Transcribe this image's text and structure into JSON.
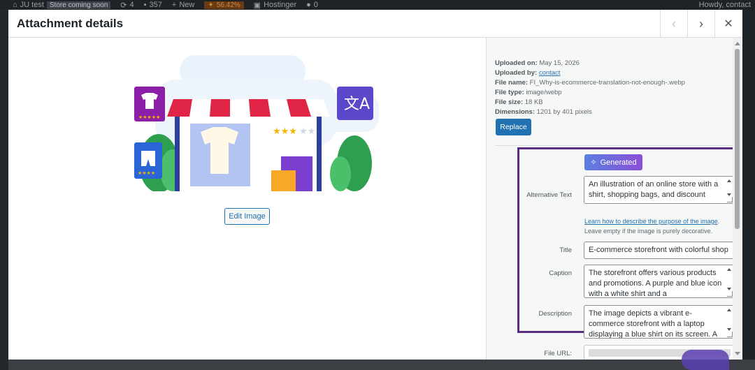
{
  "admin_bar": {
    "site_name": "JU test",
    "store_badge": "Store coming soon",
    "updates_count": "4",
    "comments_count": "357",
    "new_label": "New",
    "score": "56.42%",
    "hostinger_label": "Hostinger",
    "notifications": "0",
    "greeting": "Howdy, contact"
  },
  "modal": {
    "title": "Attachment details",
    "prev_icon": "chevron-left-icon",
    "next_icon": "chevron-right-icon",
    "close_icon": "close-icon"
  },
  "preview": {
    "edit_button_label": "Edit Image"
  },
  "details": {
    "uploaded_on_label": "Uploaded on:",
    "uploaded_on_value": "May 15, 2026",
    "uploaded_by_label": "Uploaded by:",
    "uploaded_by_value": "contact",
    "file_name_label": "File name:",
    "file_name_value": "FI_Why-is-ecommerce-translation-not-enough-.webp",
    "file_type_label": "File type:",
    "file_type_value": "image/webp",
    "file_size_label": "File size:",
    "file_size_value": "18 KB",
    "dimensions_label": "Dimensions:",
    "dimensions_value": "1201 by 401 pixels",
    "replace_label": "Replace",
    "generated_label": "Generated",
    "alt_label": "Alternative Text",
    "alt_value": "An illustration of an online store with a shirt, shopping bags, and discount",
    "help_link": "Learn how to describe the purpose of the image",
    "help_period": ".",
    "help_text": "Leave empty if the image is purely decorative.",
    "title_label": "Title",
    "title_value": "E-commerce storefront with colorful shop",
    "caption_label": "Caption",
    "caption_value": "The storefront offers various products and promotions. A purple and blue icon with a white shirt and a",
    "description_label": "Description",
    "description_value": "The image depicts a vibrant e-commerce storefront with a laptop displaying a blue shirt on its screen. A",
    "file_url_label": "File URL:"
  },
  "colors": {
    "primary": "#2271b1",
    "highlight_border": "#5b2d82",
    "generated_start": "#5b7fe0",
    "generated_end": "#8a4fd8"
  }
}
